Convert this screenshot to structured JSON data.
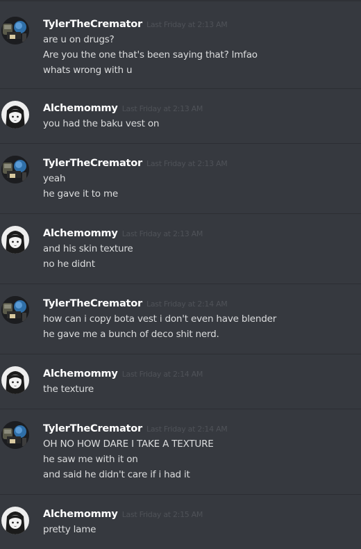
{
  "messages": [
    {
      "author": "TylerTheCremator",
      "avatar": "tyler-avatar",
      "time": "Last Friday at 2:13 AM",
      "lines": [
        "are u on drugs?",
        "Are you the one that's been saying that? lmfao",
        "whats wrong with u"
      ]
    },
    {
      "author": "Alchemommy",
      "avatar": "alchemommy-avatar",
      "time": "Last Friday at 2:13 AM",
      "lines": [
        "you had the baku vest on"
      ]
    },
    {
      "author": "TylerTheCremator",
      "avatar": "tyler-avatar",
      "time": "Last Friday at 2:13 AM",
      "lines": [
        "yeah",
        "he gave it to me"
      ]
    },
    {
      "author": "Alchemommy",
      "avatar": "alchemommy-avatar",
      "time": "Last Friday at 2:13 AM",
      "lines": [
        "and his skin texture",
        "no he didnt"
      ]
    },
    {
      "author": "TylerTheCremator",
      "avatar": "tyler-avatar",
      "time": "Last Friday at 2:14 AM",
      "lines": [
        "how can i copy bota  vest i don't even have blender",
        "he gave me a bunch of deco shit nerd."
      ]
    },
    {
      "author": "Alchemommy",
      "avatar": "alchemommy-avatar",
      "time": "Last Friday at 2:14 AM",
      "lines": [
        "the texture"
      ]
    },
    {
      "author": "TylerTheCremator",
      "avatar": "tyler-avatar",
      "time": "Last Friday at 2:14 AM",
      "lines": [
        "OH NO HOW DARE I TAKE A TEXTURE",
        "he saw me with it on",
        "and said he didn't care if i had it"
      ]
    },
    {
      "author": "Alchemommy",
      "avatar": "alchemommy-avatar",
      "time": "Last Friday at 2:15 AM",
      "lines": [
        "pretty lame"
      ]
    }
  ]
}
